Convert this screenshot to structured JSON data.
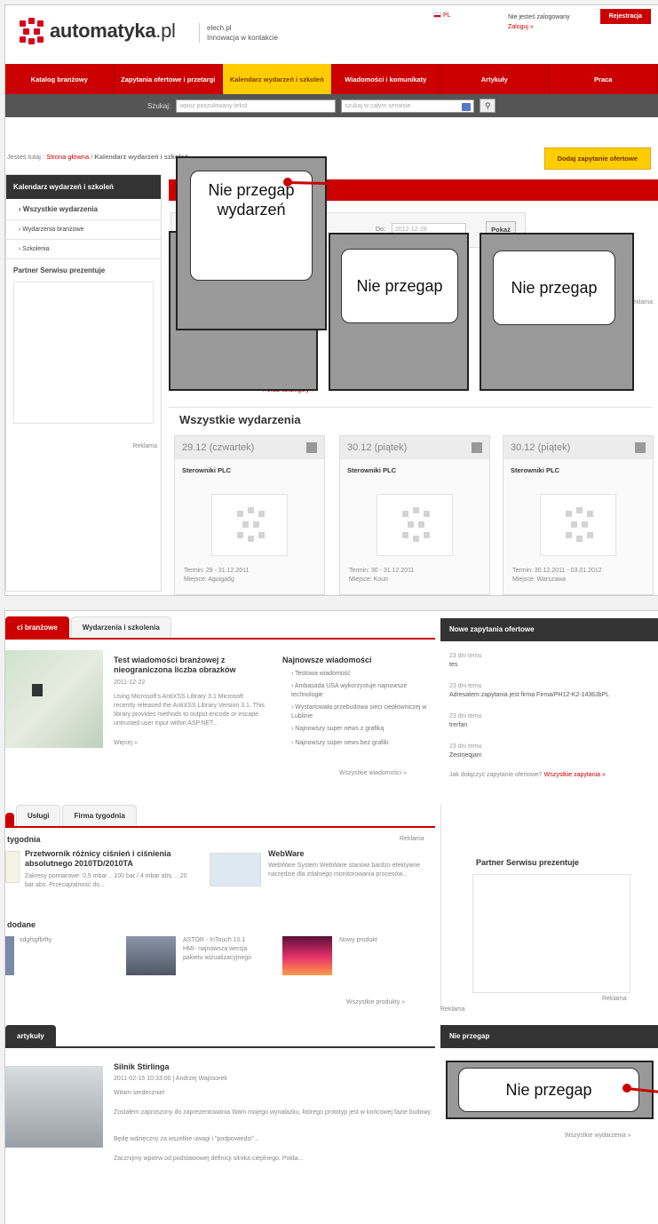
{
  "top": {
    "brand": "automatyka",
    "brand_tld": ".pl",
    "tagline1": "elech.pl",
    "tagline2": "Innowacja w kontakcie",
    "lang": "PL",
    "login_status": "Nie jesteś zalogowany",
    "login_link": "Zaloguj »",
    "register": "Rejestracja",
    "nav": [
      "Katalog branżowy",
      "Zapytania ofertowe i przetargi",
      "Kalendarz wydarzeń i szkoleń",
      "Wiadomości i komunikaty",
      "Artykuły",
      "Praca"
    ],
    "search_label": "Szukaj:",
    "search_placeholder": "wpisz poszukiwany tekst",
    "search_scope": "szukaj w całym serwisie",
    "crumb_prefix": "Jesteś tutaj :",
    "crumb_home": "Strona główna",
    "crumb_current": "Kalendarz wydarzeń i szkoleń",
    "add_button": "Dodaj zapytanie ofertowe",
    "side_header": "Kalendarz wydarzeń i szkoleń",
    "side_items": [
      "Wszystkie wydarzenia",
      "Wydarzenia branżowe",
      "Szkolenia"
    ],
    "side_partner": "Partner Serwisu prezentuje",
    "side_ad": "Reklama",
    "filter_to_label": "Do:",
    "filter_to": "2012-12-28",
    "filter_button": "Pokaż",
    "more_link": "Pokaż szczegóły »",
    "ad_right": "Reklama",
    "section": "Wszystkie wydarzenia",
    "cards": [
      {
        "day": "29.12",
        "dow": "(czwartek)",
        "title": "Sterowniki PLC",
        "term_label": "Termin:",
        "term": "29 - 31.12.2011",
        "place_label": "Miejsce:",
        "place": "Aguigadg"
      },
      {
        "day": "30.12",
        "dow": "(piątek)",
        "title": "Sterowniki PLC",
        "term_label": "Termin:",
        "term": "30 - 31.12.2011",
        "place_label": "Miejsce:",
        "place": "Kouri"
      },
      {
        "day": "30.12",
        "dow": "(piątek)",
        "title": "Sterowniki PLC",
        "term_label": "Termin:",
        "term": "30.12.2011 - 03.01.2012",
        "place_label": "Miejsce:",
        "place": "Warszawa"
      }
    ],
    "overlay_front": "Nie przegap wydarzeń",
    "overlay_mid": "Nie przegap",
    "overlay_right": "Nie przegap"
  },
  "bottom": {
    "tab1": "ci branżowe",
    "tab2": "Wydarzenia i szkolenia",
    "news_title": "Test wiadomości branżowej z nieograniczona liczba obrazków",
    "news_date": "2011-12-22",
    "news_body": "Using Microsoft's AntiXSS Library 3.1 Microsoft recently released the AntiXSS Library Version 3.1. This library provides methods to output encode or escape untrusted user input within ASP.NET...",
    "news_more": "Więcej »",
    "latest_title": "Najnowsze wiadomości",
    "latest": [
      "Testowa wiadomość",
      "Ambasada USA wykorzystuje najnowsze technologie",
      "Wystartowała przebudowa sieci ciepłowniczej w Lublinie",
      "Najnowszy super news z grafiką",
      "Najnowszy super news bez grafiki"
    ],
    "all_news": "Wszystkie wiadomości »",
    "q_header": "Nowe zapytania ofertowe",
    "queries": [
      {
        "t": "23 dni temu",
        "d": "tes"
      },
      {
        "t": "23 dni temu",
        "d": "Adresatem zapytania jest firma Firma/PH12-K2-1436JbPL"
      },
      {
        "t": "23 dni temu",
        "d": "trerfan"
      },
      {
        "t": "23 dni temu",
        "d": "Zestrjeqjam"
      }
    ],
    "q_how": "Jak dołączyć zapytanie ofertowe?",
    "q_all": "Wszystkie zapytania »",
    "tab3": "Usługi",
    "tab4": "Firma tygodnia",
    "week_title": "tygodnia",
    "week_ad": "Reklama",
    "prod1_title": "Przetwornik różnicy ciśnień i ciśnienia absolutnego 2010TD/2010TA",
    "prod1_body": "Zakresy pomiarowe: 0,5 mbar ...100 bar / 4 mbar abs. ...20 bar abs. Przeciążalność do...",
    "prod2_title": "WebWare",
    "prod2_body": "WebWare System WebWare stanowi bardzo efektywne narzędzie dla zdalnego monitorowania procesów...",
    "added_title": "dodane",
    "added1": "sdgfsgfbrfty",
    "added2": "ASTOR - InTouch 10.1 HMI- najnowsza wersja pakietu wizualizacyjnego",
    "added3": "Nowy produkt",
    "all_products": "Wszystkie produkty »",
    "partner": "Partner Serwisu prezentuje",
    "partner_ad": "Reklama",
    "left_ad": "Reklama",
    "art_tab": "artykuły",
    "art_title": "Silnik Stirlinga",
    "art_meta": "2011-02-15 10:33:00 | Andrzej Wajssorek",
    "art_p1": "Witam serdecznie!",
    "art_p2": "Zostałem zaproszony do zaprezentowania Wam mojego wynalazku, którego prototyp jest w końcowej fazie budowy.",
    "art_p3": "Będę wdzięczny za wszelkie uwagi i \"podpowiedzi\"...",
    "art_p4": "Zacznijmy wpierw od podstawowej definicji silnika cieplnego. Pokła...",
    "np_header": "Nie przegap",
    "np_label": "Nie przegap",
    "np_all": "Wszystkie wydarzenia »"
  }
}
